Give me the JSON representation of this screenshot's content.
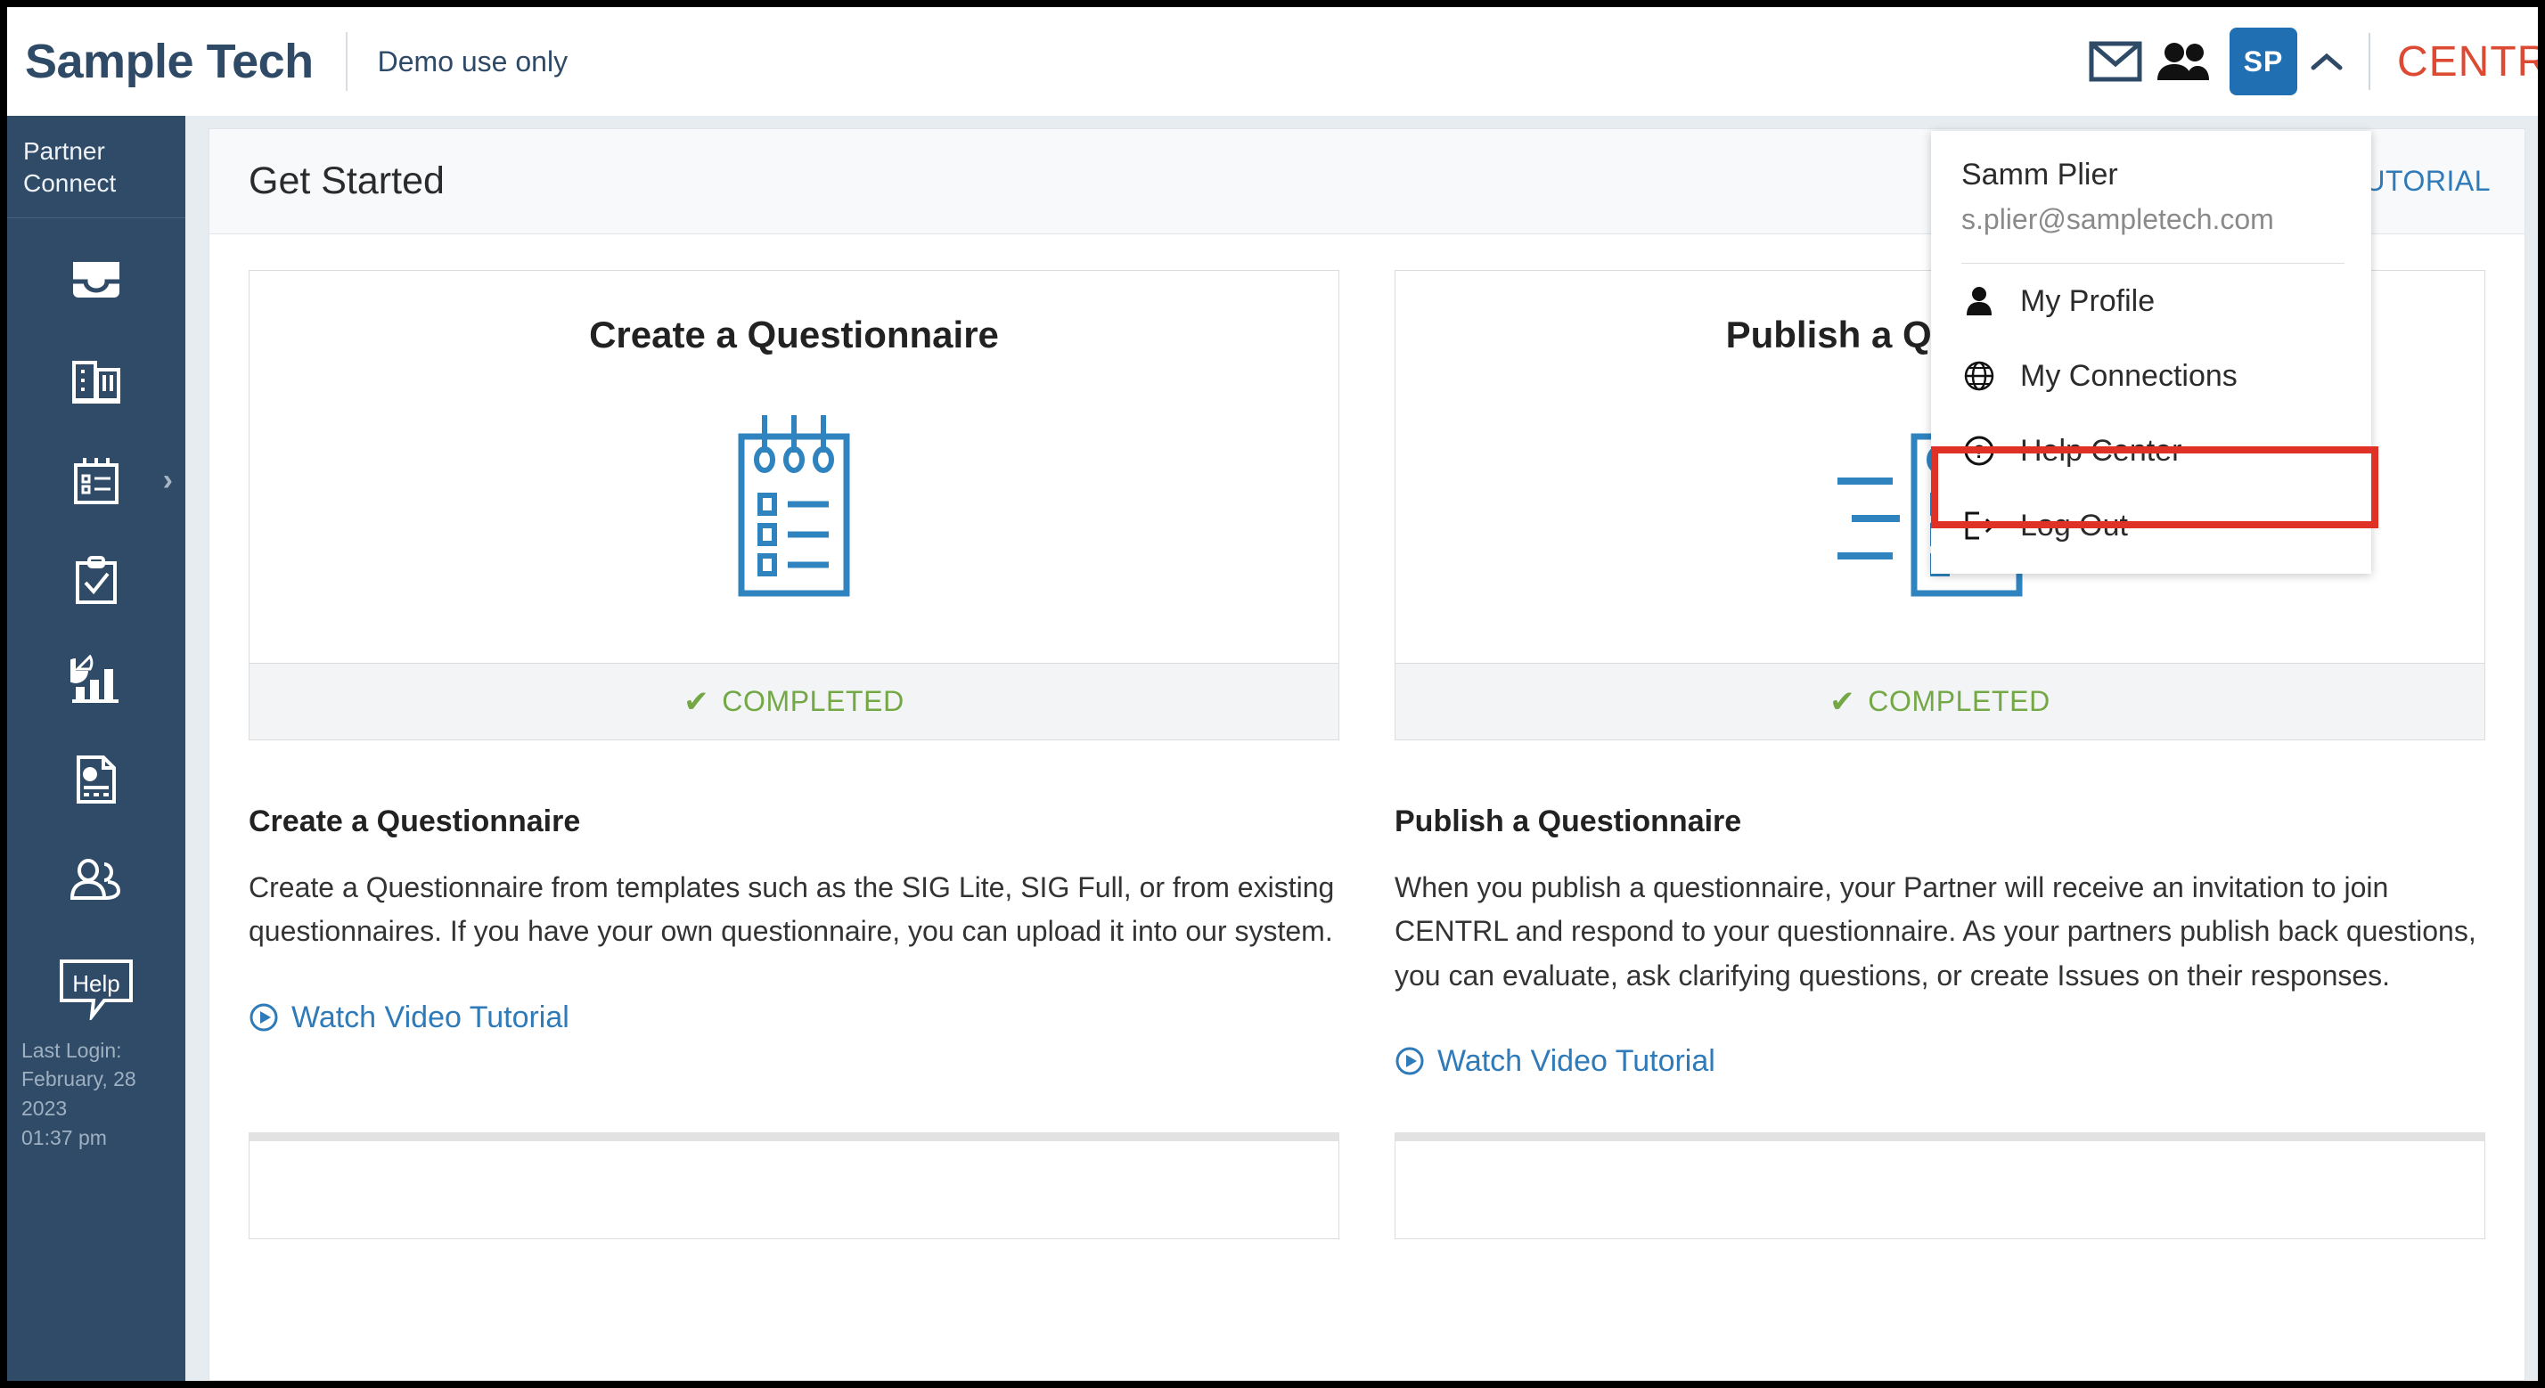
{
  "header": {
    "brand": "Sample Tech",
    "demo_note": "Demo use only",
    "avatar_initials": "SP",
    "product_logo": "CENTRL",
    "icons": {
      "mail": "mail-icon",
      "people": "people-icon",
      "caret": "chevron-up-icon"
    }
  },
  "sidebar": {
    "title": "Partner Connect",
    "items": [
      {
        "name": "inbox-icon",
        "label": "Inbox"
      },
      {
        "name": "buildings-icon",
        "label": "Organizations"
      },
      {
        "name": "questionnaire-icon",
        "label": "Questionnaires",
        "has_chevron": true
      },
      {
        "name": "clipboard-check-icon",
        "label": "Assessments"
      },
      {
        "name": "analytics-icon",
        "label": "Analytics"
      },
      {
        "name": "report-icon",
        "label": "Reports"
      },
      {
        "name": "users-icon",
        "label": "Users"
      }
    ],
    "help_label": "Help",
    "last_login_label": "Last Login:",
    "last_login_date": "February, 28 2023",
    "last_login_time": "01:37 pm"
  },
  "panel": {
    "title": "Get Started",
    "header_link": "ALL VIDEO TUTORIAL"
  },
  "cards": [
    {
      "title": "Create a Questionnaire",
      "status": "COMPLETED",
      "status_icon": "check-icon",
      "art": "questionnaire-notepad-icon"
    },
    {
      "title": "Publish a Questionnaire",
      "status": "COMPLETED",
      "status_icon": "check-icon",
      "art": "publish-questionnaire-icon"
    }
  ],
  "sections": [
    {
      "heading": "Create a Questionnaire",
      "body": "Create a Questionnaire from templates such as the SIG Lite, SIG Full, or from existing questionnaires. If you have your own questionnaire, you can upload it into our system.",
      "link": "Watch Video Tutorial"
    },
    {
      "heading": "Publish a Questionnaire",
      "body": "When you publish a questionnaire, your Partner will receive an invitation to join CENTRL and respond to your questionnaire. As your partners publish back questions, you can evaluate, ask clarifying questions, or create Issues on their responses.",
      "link": "Watch Video Tutorial"
    }
  ],
  "dropdown": {
    "user_name": "Samm Plier",
    "user_email": "s.plier@sampletech.com",
    "items": [
      {
        "label": "My Profile",
        "icon": "user-icon"
      },
      {
        "label": "My Connections",
        "icon": "globe-icon"
      },
      {
        "label": "Help Center",
        "icon": "question-circle-icon",
        "highlighted": true
      },
      {
        "label": "Log Out",
        "icon": "logout-icon"
      }
    ]
  },
  "colors": {
    "sidebar": "#2f4b68",
    "brand_text": "#2e4a67",
    "accent_blue": "#2f7ab8",
    "avatar_blue": "#1f6fb2",
    "logo_red": "#dd4a33",
    "status_green": "#73a845",
    "highlight_red": "#e03127"
  }
}
